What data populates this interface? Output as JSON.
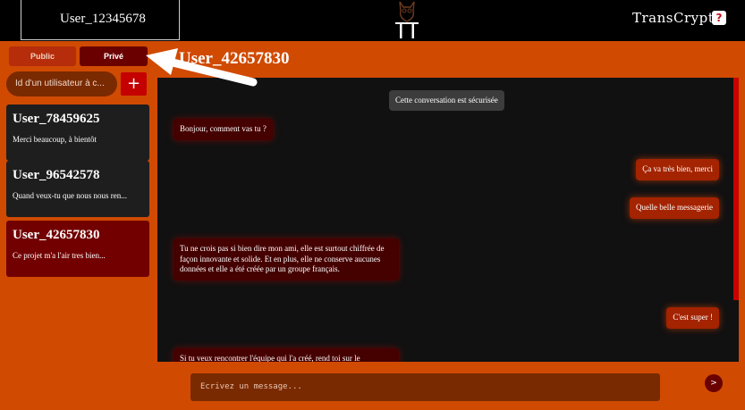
{
  "header": {
    "current_user": "User_12345678",
    "brand": "TransCrypt",
    "help_label": "?"
  },
  "tabs": {
    "public_label": "Public",
    "private_label": "Privé"
  },
  "search": {
    "placeholder": "Id d'un utilisateur à c...",
    "add_label": "+"
  },
  "conversations": [
    {
      "name": "User_78459625",
      "preview": "Merci beaucoup, à bientôt"
    },
    {
      "name": "User_96542578",
      "preview": "Quand veux-tu que nous nous ren..."
    },
    {
      "name": "User_42657830",
      "preview": "Ce projet m'a l'air tres bien..."
    }
  ],
  "chat": {
    "title": "User_42657830",
    "notice": "Cette conversation est sécurisée",
    "messages": [
      {
        "direction": "in",
        "text": "Bonjour, comment vas tu ?"
      },
      {
        "direction": "out",
        "text": "Ça va très bien, merci"
      },
      {
        "direction": "out",
        "text": "Quelle belle messagerie"
      },
      {
        "direction": "in",
        "text": "Tu ne crois pas si bien dire mon ami, elle est surtout chiffrée de façon innovante et solide. Et en plus, elle ne conserve aucunes données et elle a été créée par un groupe français."
      },
      {
        "direction": "out",
        "text": "C'est super !"
      },
      {
        "direction": "in",
        "text": "Si tu veux rencontrer l'équipe qui l'a créé, rend toi sur le"
      }
    ]
  },
  "composer": {
    "placeholder": "Ecrivez un message...",
    "send_label": ">"
  },
  "colors": {
    "accent": "#d04a02",
    "active_conversation": "#720000",
    "incoming_bubble": "#450000",
    "outgoing_bubble": "#a42300"
  }
}
